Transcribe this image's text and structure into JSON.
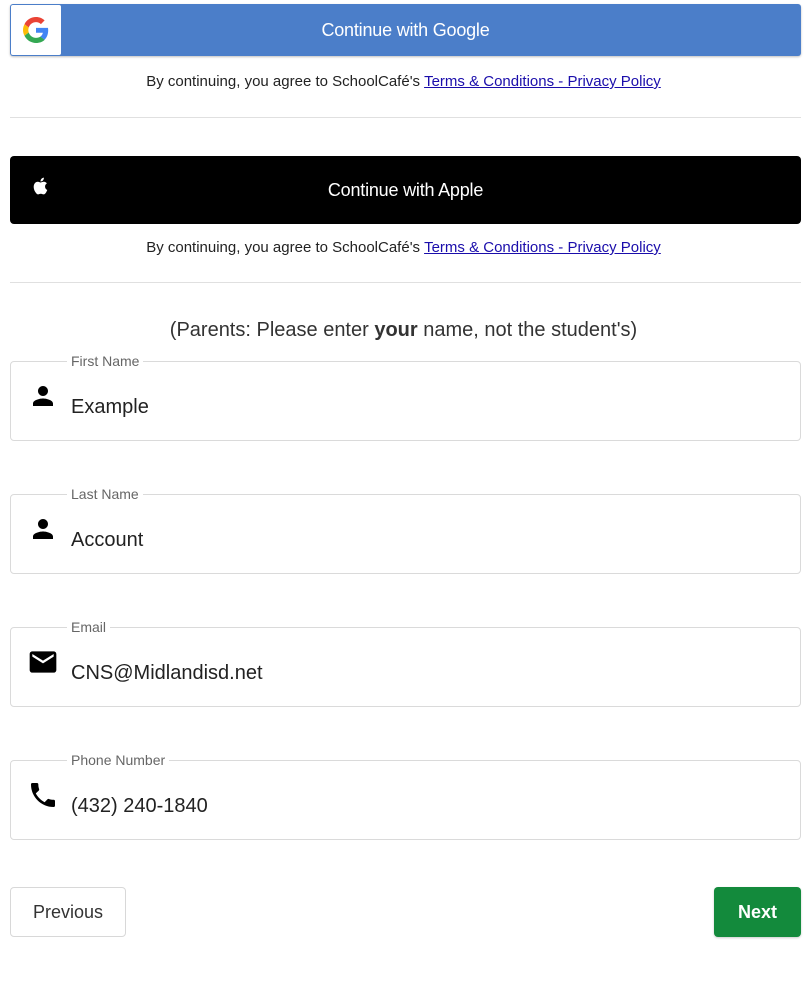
{
  "google": {
    "label": "Continue with Google",
    "icon": "google-logo-icon",
    "color": "#4b7ec9"
  },
  "google_agree": {
    "text": "By continuing, you agree to SchoolCafé's",
    "link": "Terms & Conditions - Privacy Policy"
  },
  "apple": {
    "label": "Continue with Apple",
    "icon": "apple-logo-icon",
    "color": "#000000"
  },
  "apple_agree": {
    "text": "By continuing, you agree to SchoolCafé's",
    "link": "Terms & Conditions - Privacy Policy"
  },
  "note": {
    "prefix": "(Parents: Please enter ",
    "bold": "your",
    "suffix": " name, not the student's)"
  },
  "fields": {
    "first_name": {
      "label": "First Name",
      "value": "Example",
      "icon": "person-icon"
    },
    "last_name": {
      "label": "Last Name",
      "value": "Account",
      "icon": "person-icon"
    },
    "email": {
      "label": "Email",
      "value": "CNS@Midlandisd.net",
      "icon": "mail-icon"
    },
    "phone": {
      "label": "Phone Number",
      "value": "(432) 240-1840",
      "icon": "phone-icon"
    }
  },
  "nav": {
    "previous": "Previous",
    "next": "Next",
    "next_color": "#138a3c"
  }
}
